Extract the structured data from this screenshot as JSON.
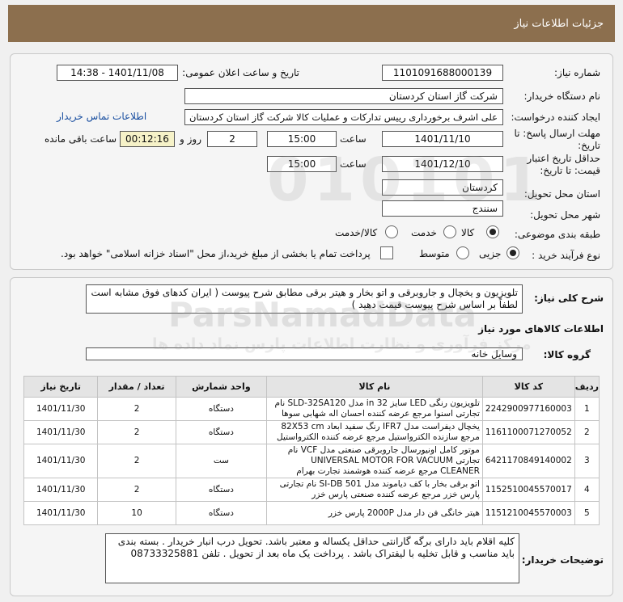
{
  "header": {
    "title": "جزئیات اطلاعات نیاز"
  },
  "form": {
    "need_number_label": "شماره نیاز:",
    "need_number": "1101091688000139",
    "announce_label": "تاریخ و ساعت اعلان عمومی:",
    "announce_value": "1401/11/08 - 14:38",
    "buyer_org_label": "نام دستگاه خریدار:",
    "buyer_org": "شرکت گاز استان کردستان",
    "creator_label": "ایجاد کننده درخواست:",
    "creator": "علی اشرف برخورداری رییس تدارکات و عملیات کالا شرکت گاز استان کردستان",
    "contact_link": "اطلاعات تماس خریدار",
    "deadline_label_1": "مهلت ارسال پاسخ: تا",
    "deadline_label_2": "تاریخ:",
    "deadline_date": "1401/11/10",
    "time_label": "ساعت",
    "deadline_time": "15:00",
    "days_value": "2",
    "days_label": "روز و",
    "remaining_time": "00:12:16",
    "remaining_label": "ساعت باقی مانده",
    "validity_label_1": "حداقل تاریخ اعتبار",
    "validity_label_2": "قیمت: تا تاریخ:",
    "validity_date": "1401/12/10",
    "validity_time_label": "ساعت",
    "validity_time": "15:00",
    "province_label": "استان محل تحویل:",
    "province": "کردستان",
    "city_label": "شهر محل تحویل:",
    "city": "سنندج",
    "category_label": "طبقه بندی موضوعی:",
    "category_options": [
      "کالا",
      "خدمت",
      "کالا/خدمت"
    ],
    "category_selected": "کالا",
    "process_label": "نوع فرآیند خرید :",
    "process_options": [
      "جزیی",
      "متوسط"
    ],
    "process_selected": "جزیی",
    "payment_checkbox_label": "پرداخت تمام یا بخشی از مبلغ خرید،از محل \"اسناد خزانه اسلامی\" خواهد بود."
  },
  "summary": {
    "label": "شرح کلی نیاز:",
    "text": "تلویزیون و یخچال و جاروبرقی و اتو بخار و هیتر برقی مطابق شرح پیوست ( ایران کدهای فوق مشابه است لطفاً بر اساس شرح پیوست قیمت دهید )"
  },
  "goods": {
    "section_title": "اطلاعات کالاهای مورد نیاز",
    "group_label": "گروه کالا:",
    "group_value": "وسایل خانه",
    "columns": [
      "ردیف",
      "کد کالا",
      "نام کالا",
      "واحد شمارش",
      "تعداد / مقدار",
      "تاریخ نیاز"
    ],
    "rows": [
      {
        "idx": "1",
        "code": "2242900977160003",
        "name": "تلویزیون رنگی LED سایز 32 in مدل SLD-32SA120 نام تجارتی اسنوا مرجع عرضه کننده احسان اله شهابی سوها",
        "unit": "دستگاه",
        "qty": "2",
        "date": "1401/11/30"
      },
      {
        "idx": "2",
        "code": "1161100071270052",
        "name": "یخچال دیفراست مدل IFR7 رنگ سفید ابعاد 82X53 cm مرجع سازنده الکترواستیل مرجع عرضه کننده الکترواستیل",
        "unit": "دستگاه",
        "qty": "2",
        "date": "1401/11/30"
      },
      {
        "idx": "3",
        "code": "6421170849140002",
        "name": "موتور کامل اونیورسال جاروبرقی صنعتی مدل VCF نام تجارتی UNIVERSAL MOTOR FOR VACUUM CLEANER مرجع عرضه کننده هوشمند تجارت بهرام",
        "unit": "ست",
        "qty": "2",
        "date": "1401/11/30"
      },
      {
        "idx": "4",
        "code": "1152510045570017",
        "name": "اتو برقی بخار با کف دیاموند مدل SI-DB 501 نام تجارتی پارس خزر مرجع عرضه کننده صنعتی پارس خزر",
        "unit": "دستگاه",
        "qty": "2",
        "date": "1401/11/30"
      },
      {
        "idx": "5",
        "code": "1151210045570003",
        "name": "هیتر خانگی فن دار مدل 2000P پارس خزر",
        "unit": "دستگاه",
        "qty": "10",
        "date": "1401/11/30"
      }
    ]
  },
  "buyer_notes": {
    "label": "توضیحات خریدار:",
    "text": "کلیه اقلام باید دارای برگه گارانتی حداقل یکساله و معتبر باشد. تحویل درب انبار خریدار . بسته بندی باید مناسب و قابل تخلیه با لیفتراک باشد . پرداخت یک ماه بعد از تحویل . تلفن 08733325881"
  },
  "watermark": {
    "brand": "ParsNamadData",
    "tagline": "مرکز فرآوری و نظارت اطلاعات پارس نماد داده ها",
    "code": "010101"
  },
  "colors": {
    "header_bg": "#8c6f4e",
    "link": "#1a4fa0",
    "remaining_bg": "#f6f2c8"
  }
}
